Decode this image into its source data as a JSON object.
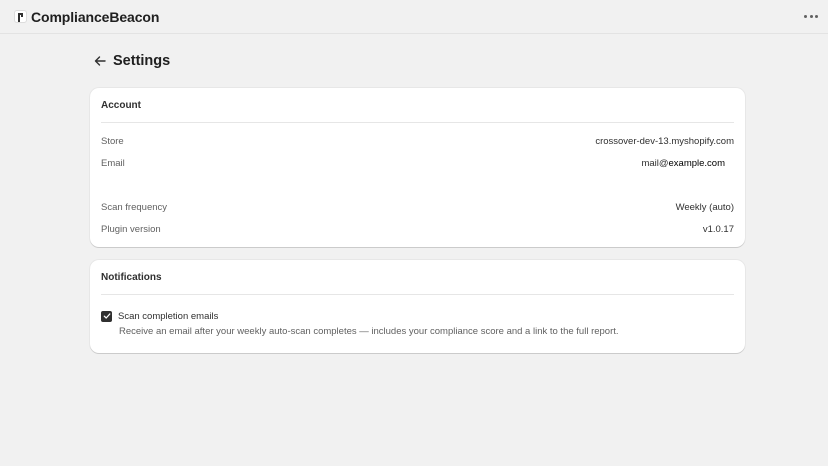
{
  "app": {
    "title": "ComplianceBeacon"
  },
  "page": {
    "title": "Settings"
  },
  "account": {
    "title": "Account",
    "store_label": "Store",
    "store_value": "crossover-dev-13.myshopify.com",
    "email_label": "Email",
    "email_user": "mail@",
    "email_domain": "example.com",
    "scan_frequency_label": "Scan frequency",
    "scan_frequency_value": "Weekly (auto)",
    "plugin_version_label": "Plugin version",
    "plugin_version_value": "v1.0.17"
  },
  "notifications": {
    "title": "Notifications",
    "scan_emails_label": "Scan completion emails",
    "scan_emails_checked": true,
    "scan_emails_description": "Receive an email after your weekly auto-scan completes — includes your compliance score and a link to the full report."
  },
  "icons": {
    "logo": "beacon-logo-icon",
    "more": "ellipsis-icon",
    "back": "arrow-left-icon",
    "check": "checkmark-icon"
  },
  "colors": {
    "background": "#f1f1f1",
    "card": "#ffffff",
    "text": "#303030",
    "muted": "#616161",
    "checkbox": "#303030"
  }
}
